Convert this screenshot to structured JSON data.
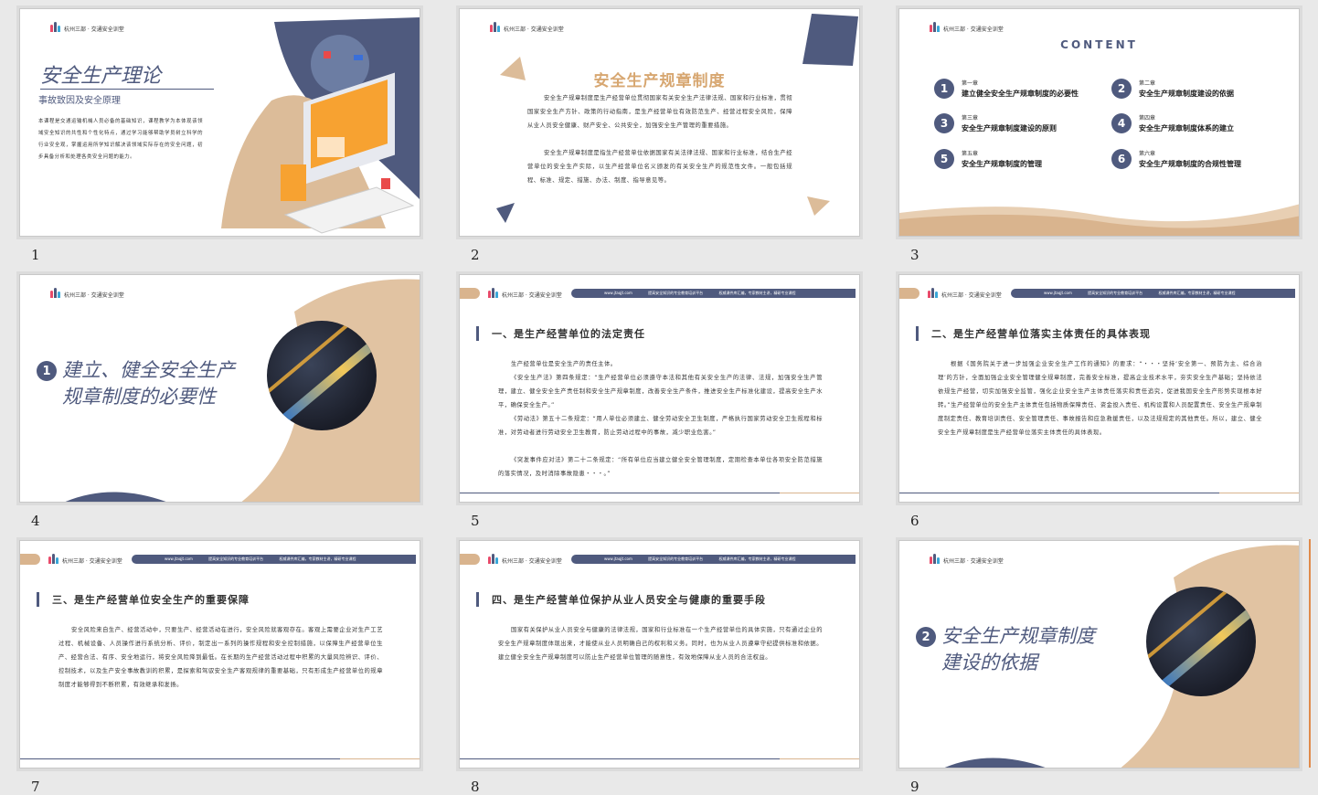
{
  "logo_text": "杭州三部 · 交通安全训堂",
  "slide_numbers": [
    "1",
    "2",
    "3",
    "4",
    "5",
    "6",
    "7",
    "8",
    "9"
  ],
  "header_bar": {
    "site": "www.jtaqjt.com",
    "slogan1": "提高安全知识的专业教育培训平台",
    "slogan2": "权威课件库汇编，专家教材主讲，精研专业课程"
  },
  "slide1": {
    "title": "安全生产理论",
    "subtitle": "事故致因及安全原理",
    "body": "本课程是交通运输机械人员必备的基础知识，课程教学为本体现该领域安全知识的共性和个性化特点，通过学习能够帮助学员树立科学的行业安全观，掌握运用所学知识解决该领域实际存在的安全问题，初步具备分析和处理各类安全问题的能力。"
  },
  "slide2": {
    "title": "安全生产规章制度",
    "p1": "安全生产规章制度是生产经营单位贯彻国家有关安全生产法律法规、国家和行业标准，贯彻国家安全生产方针、政策的行动指南，是生产经营单位有效防范生产、经营过程安全风险，保障从业人员安全健康、财产安全、公共安全，加强安全生产管理的重要措施。",
    "p2": "安全生产规章制度是指生产经营单位依据国家有关法律法规、国家和行业标准，结合生产经营单位的安全生产实际，以生产经营单位名义颁发的有关安全生产的规范性文件。一般包括规程、标准、规定、措施、办法、制度、指导意见等。"
  },
  "slide3": {
    "heading": "CONTENT",
    "items": [
      {
        "num": "1",
        "chapter": "第一章",
        "title": "建立健全安全生产规章制度的必要性"
      },
      {
        "num": "2",
        "chapter": "第二章",
        "title": "安全生产规章制度建设的依据"
      },
      {
        "num": "3",
        "chapter": "第三章",
        "title": "安全生产规章制度建设的原则"
      },
      {
        "num": "4",
        "chapter": "第四章",
        "title": "安全生产规章制度体系的建立"
      },
      {
        "num": "5",
        "chapter": "第五章",
        "title": "安全生产规章制度的管理"
      },
      {
        "num": "6",
        "chapter": "第六章",
        "title": "安全生产规章制度的合规性管理"
      }
    ]
  },
  "slide4": {
    "num": "1",
    "line1": "建立、健全安全生产",
    "line2": "规章制度的必要性"
  },
  "slide5": {
    "title": "一、是生产经营单位的法定责任",
    "p1": "生产经营单位是安全生产的责任主体。",
    "p2": "《安全生产法》第四条规定：“生产经营单位必须遵守本法和其他有关安全生产的法律、法规，加强安全生产管理，建立、健全安全生产责任制和安全生产规章制度，改善安全生产条件，推进安全生产标准化建设，提高安全生产水平，确保安全生产。”",
    "p3": "《劳动法》第五十二条规定：“用人单位必须建立、健全劳动安全卫生制度，严格执行国家劳动安全卫生规程和标准，对劳动者进行劳动安全卫生教育，防止劳动过程中的事故，减少职业危害。”",
    "p4": "《突发事件应对法》第二十二条规定：“所有单位应当建立健全安全管理制度，定期检查本单位各项安全防范措施的落实情况，及时消除事故隐患・・・。”"
  },
  "slide6": {
    "title": "二、是生产经营单位落实主体责任的具体表现",
    "p1": "根据《国务院关于进一步加强企业安全生产工作的通知》的要求：“・・・坚持‘安全第一、预防为主、综合治理’的方针，全面加强企业安全管理健全规章制度，完善安全标准，提高企业技术水平，夯实安全生产基础；坚持依法依规生产经营，切实加强安全监管，强化企业安全生产主体责任落实和责任追究，促进我国安全生产形势实现根本好转。”生产经营单位的安全生产主体责任包括物质保障责任、资金投入责任、机构设置和人员配置责任、安全生产规章制度制定责任、教育培训责任、安全管理责任、事故报告和应急救援责任，以及法规规定的其他责任。所以，建立、健全安全生产规章制度是生产经营单位落实主体责任的具体表现。"
  },
  "slide7": {
    "title": "三、是生产经营单位安全生产的重要保障",
    "p1": "安全风险来自生产、经营活动中，只要生产、经营活动在进行，安全风险就客观存在。客观上需要企业对生产工艺过程、机械设备、人员操作进行系统分析、评价，制定出一系列的操作规程和安全控制措施，以保障生产经营单位生产、经营合法、有序、安全地运行，将安全风险降到最低。在长期的生产经营活动过程中积累的大量风险辨识、评价、控制技术，以及生产安全事故教训的积累，是探索和驾驭安全生产客观规律的重要基础，只有形成生产经营单位的规章制度才能够得到不断积累，有效继承和发扬。"
  },
  "slide8": {
    "title": "四、是生产经营单位保护从业人员安全与健康的重要手段",
    "p1": "国家有关保护从业人员安全与健康的法律法规，国家和行业标准在一个生产经营单位的具体实施，只有通过企业的安全生产规章制度体现出来，才能使从业人员明确自己的权利和义务。同时，也为从业人员遵章守纪提供标准和依据。建立健全安全生产规章制度可以防止生产经营单位管理的随意性，有效地保障从业人员的合法权益。"
  },
  "slide9": {
    "num": "2",
    "line1": "安全生产规章制度",
    "line2": "建设的依据"
  },
  "colors": {
    "navy": "#4f5a7e",
    "tan": "#d9b48e",
    "orange": "#f7a231",
    "gold_title": "#d7a771"
  }
}
